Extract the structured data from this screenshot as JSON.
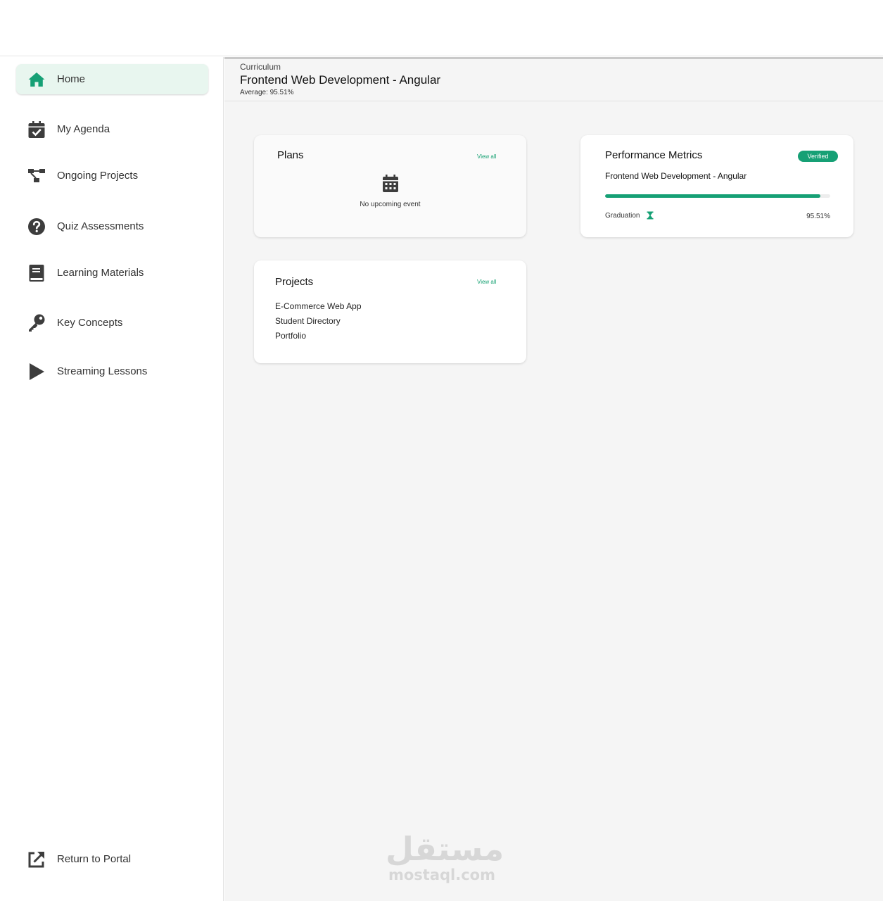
{
  "sidebar": {
    "items": [
      {
        "label": "Home",
        "icon": "home-icon"
      },
      {
        "label": "My Agenda",
        "icon": "calendar-check-icon"
      },
      {
        "label": "Ongoing Projects",
        "icon": "project-diagram-icon"
      },
      {
        "label": "Quiz Assessments",
        "icon": "question-circle-icon"
      },
      {
        "label": "Learning Materials",
        "icon": "book-icon"
      },
      {
        "label": "Key Concepts",
        "icon": "key-icon"
      },
      {
        "label": "Streaming Lessons",
        "icon": "play-icon"
      }
    ],
    "footer": {
      "label": "Return to Portal",
      "icon": "external-link-icon"
    }
  },
  "header": {
    "crumb": "Curriculum",
    "title": "Frontend Web Development - Angular",
    "average": "Average: 95.51%"
  },
  "plans": {
    "title": "Plans",
    "view_all": "View all",
    "empty_text": "No upcoming event"
  },
  "metrics": {
    "title": "Performance Metrics",
    "badge": "Verified",
    "course": "Frontend Web Development - Angular",
    "progress_percent": 95.51,
    "grad_label": "Graduation",
    "grad_value": "95.51%"
  },
  "projects": {
    "title": "Projects",
    "view_all": "View all",
    "items": [
      "E-Commerce Web App",
      "Student Directory",
      "Portfolio"
    ]
  },
  "watermark": {
    "arabic": "مستقل",
    "latin": "mostaql.com"
  },
  "colors": {
    "accent": "#16a075",
    "active_bg": "#e8f6ef",
    "icon": "#3d3d3d"
  }
}
